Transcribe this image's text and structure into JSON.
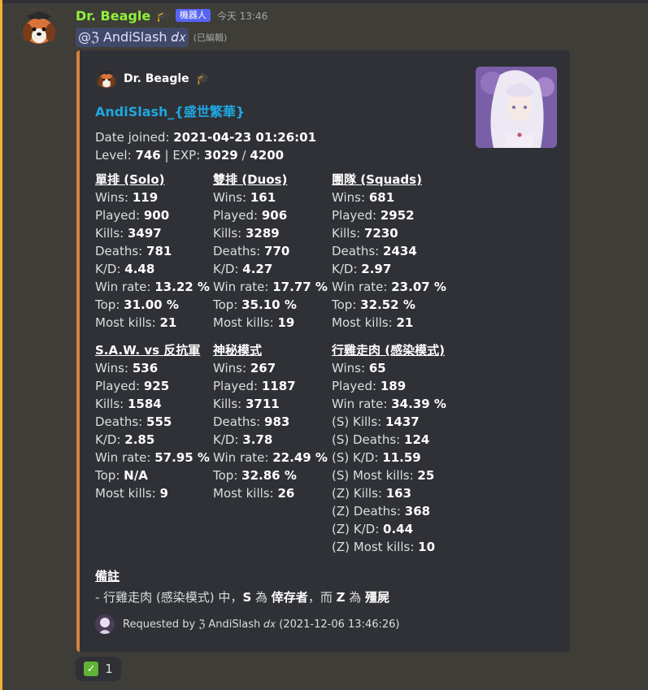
{
  "message": {
    "username": "Dr. Beagle",
    "badge_icon": "graduation-cap-icon",
    "bot_tag": "機器人",
    "timestamp": "今天 13:46",
    "mention": "@ℨ AndiSlash 𝑑𝑥",
    "edited": "(已編輯)"
  },
  "embed": {
    "author_name": "Dr. Beagle",
    "title": "AndiSlash_{盛世繁華}",
    "date_joined_label": "Date joined:",
    "date_joined_value": "2021-04-23 01:26:01",
    "level_label": "Level:",
    "level_value": "746",
    "exp_label": "| EXP:",
    "exp_current": "3029",
    "exp_sep": "/",
    "exp_max": "4200",
    "fields": [
      {
        "name": "單排 (Solo)",
        "stats": [
          {
            "label": "Wins:",
            "value": "119"
          },
          {
            "label": "Played:",
            "value": "900"
          },
          {
            "label": "Kills:",
            "value": "3497"
          },
          {
            "label": "Deaths:",
            "value": "781"
          },
          {
            "label": "K/D:",
            "value": "4.48"
          },
          {
            "label": "Win rate:",
            "value": "13.22 %"
          },
          {
            "label": "Top:",
            "value": "31.00 %"
          },
          {
            "label": "Most kills:",
            "value": "21"
          }
        ]
      },
      {
        "name": "雙排 (Duos)",
        "stats": [
          {
            "label": "Wins:",
            "value": "161"
          },
          {
            "label": "Played:",
            "value": "906"
          },
          {
            "label": "Kills:",
            "value": "3289"
          },
          {
            "label": "Deaths:",
            "value": "770"
          },
          {
            "label": "K/D:",
            "value": "4.27"
          },
          {
            "label": "Win rate:",
            "value": "17.77 %"
          },
          {
            "label": "Top:",
            "value": "35.10 %"
          },
          {
            "label": "Most kills:",
            "value": "19"
          }
        ]
      },
      {
        "name": "團隊 (Squads)",
        "stats": [
          {
            "label": "Wins:",
            "value": "681"
          },
          {
            "label": "Played:",
            "value": "2952"
          },
          {
            "label": "Kills:",
            "value": "7230"
          },
          {
            "label": "Deaths:",
            "value": "2434"
          },
          {
            "label": "K/D:",
            "value": "2.97"
          },
          {
            "label": "Win rate:",
            "value": "23.07 %"
          },
          {
            "label": "Top:",
            "value": "32.52 %"
          },
          {
            "label": "Most kills:",
            "value": "21"
          }
        ]
      },
      {
        "name": "S.A.W. vs 反抗軍",
        "stats": [
          {
            "label": "Wins:",
            "value": "536"
          },
          {
            "label": "Played:",
            "value": "925"
          },
          {
            "label": "Kills:",
            "value": "1584"
          },
          {
            "label": "Deaths:",
            "value": "555"
          },
          {
            "label": "K/D:",
            "value": "2.85"
          },
          {
            "label": "Win rate:",
            "value": "57.95 %"
          },
          {
            "label": "Top:",
            "value": "N/A"
          },
          {
            "label": "Most kills:",
            "value": "9"
          }
        ]
      },
      {
        "name": "神秘模式",
        "stats": [
          {
            "label": "Wins:",
            "value": "267"
          },
          {
            "label": "Played:",
            "value": "1187"
          },
          {
            "label": "Kills:",
            "value": "3711"
          },
          {
            "label": "Deaths:",
            "value": "983"
          },
          {
            "label": "K/D:",
            "value": "3.78"
          },
          {
            "label": "Win rate:",
            "value": "22.49 %"
          },
          {
            "label": "Top:",
            "value": "32.86 %"
          },
          {
            "label": "Most kills:",
            "value": "26"
          }
        ]
      },
      {
        "name": "行雞走肉 (感染模式)",
        "stats": [
          {
            "label": "Wins:",
            "value": "65"
          },
          {
            "label": "Played:",
            "value": "189"
          },
          {
            "label": "Win rate:",
            "value": "34.39 %"
          },
          {
            "label": "(S) Kills:",
            "value": "1437"
          },
          {
            "label": "(S) Deaths:",
            "value": "124"
          },
          {
            "label": "(S) K/D:",
            "value": "11.59"
          },
          {
            "label": "(S) Most kills:",
            "value": "25"
          },
          {
            "label": "(Z) Kills:",
            "value": "163"
          },
          {
            "label": "(Z) Deaths:",
            "value": "368"
          },
          {
            "label": "(Z) K/D:",
            "value": "0.44"
          },
          {
            "label": "(Z) Most kills:",
            "value": "10"
          }
        ]
      }
    ],
    "note_title": "備註",
    "note_prefix": "- 行雞走肉 (感染模式) 中，",
    "note_s": "S",
    "note_mid1": " 為 ",
    "note_survivor": "倖存者",
    "note_mid2": "，而 ",
    "note_z": "Z",
    "note_mid3": " 為 ",
    "note_zombie": "殭屍",
    "footer_text": "Requested by ℨ AndiSlash 𝑑𝑥 (2021-12-06 13:46:26)"
  },
  "reaction": {
    "icon": "check-mark-icon",
    "count": "1"
  }
}
